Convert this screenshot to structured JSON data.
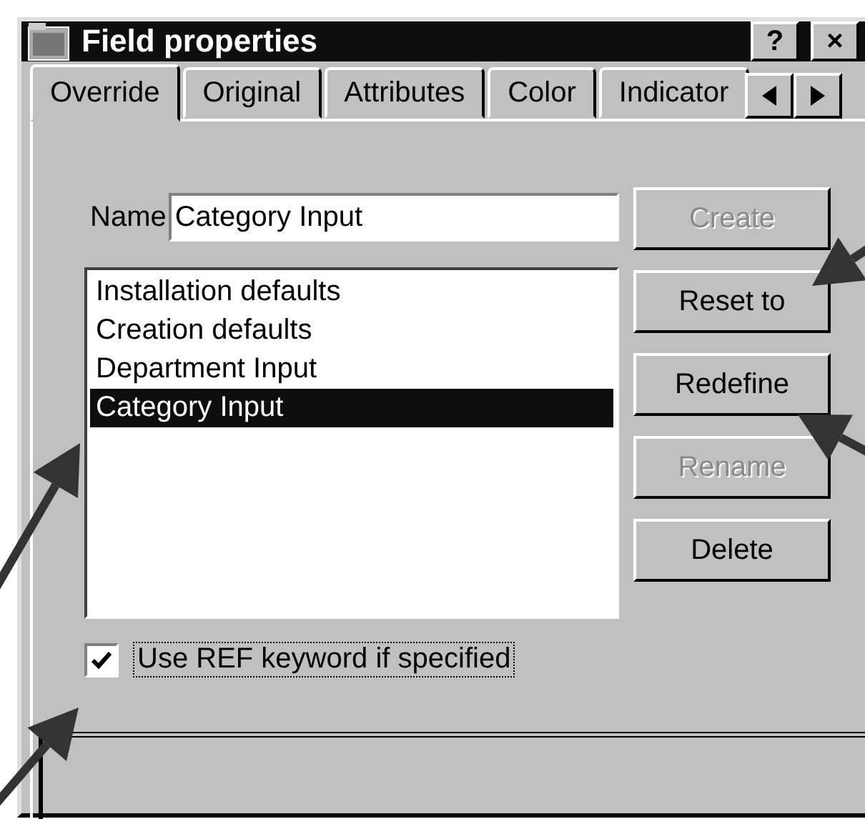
{
  "window": {
    "title": "Field properties",
    "title_buttons": [
      "?",
      "×"
    ]
  },
  "tabs": [
    {
      "label": "Override",
      "selected": true
    },
    {
      "label": "Original",
      "selected": false
    },
    {
      "label": "Attributes",
      "selected": false
    },
    {
      "label": "Color",
      "selected": false
    },
    {
      "label": "Indicator",
      "selected": false
    }
  ],
  "name_field": {
    "label": "Name",
    "value": "Category Input"
  },
  "list": [
    {
      "label": "Installation defaults",
      "selected": false
    },
    {
      "label": "Creation defaults",
      "selected": false
    },
    {
      "label": "Department Input",
      "selected": false
    },
    {
      "label": "Category Input",
      "selected": true
    }
  ],
  "buttons": [
    {
      "label": "Create",
      "disabled": true
    },
    {
      "label": "Reset to",
      "disabled": false
    },
    {
      "label": "Redefine",
      "disabled": false
    },
    {
      "label": "Rename",
      "disabled": true
    },
    {
      "label": "Delete",
      "disabled": false
    }
  ],
  "checkbox": {
    "label": "Use REF keyword if specified",
    "checked": true
  }
}
